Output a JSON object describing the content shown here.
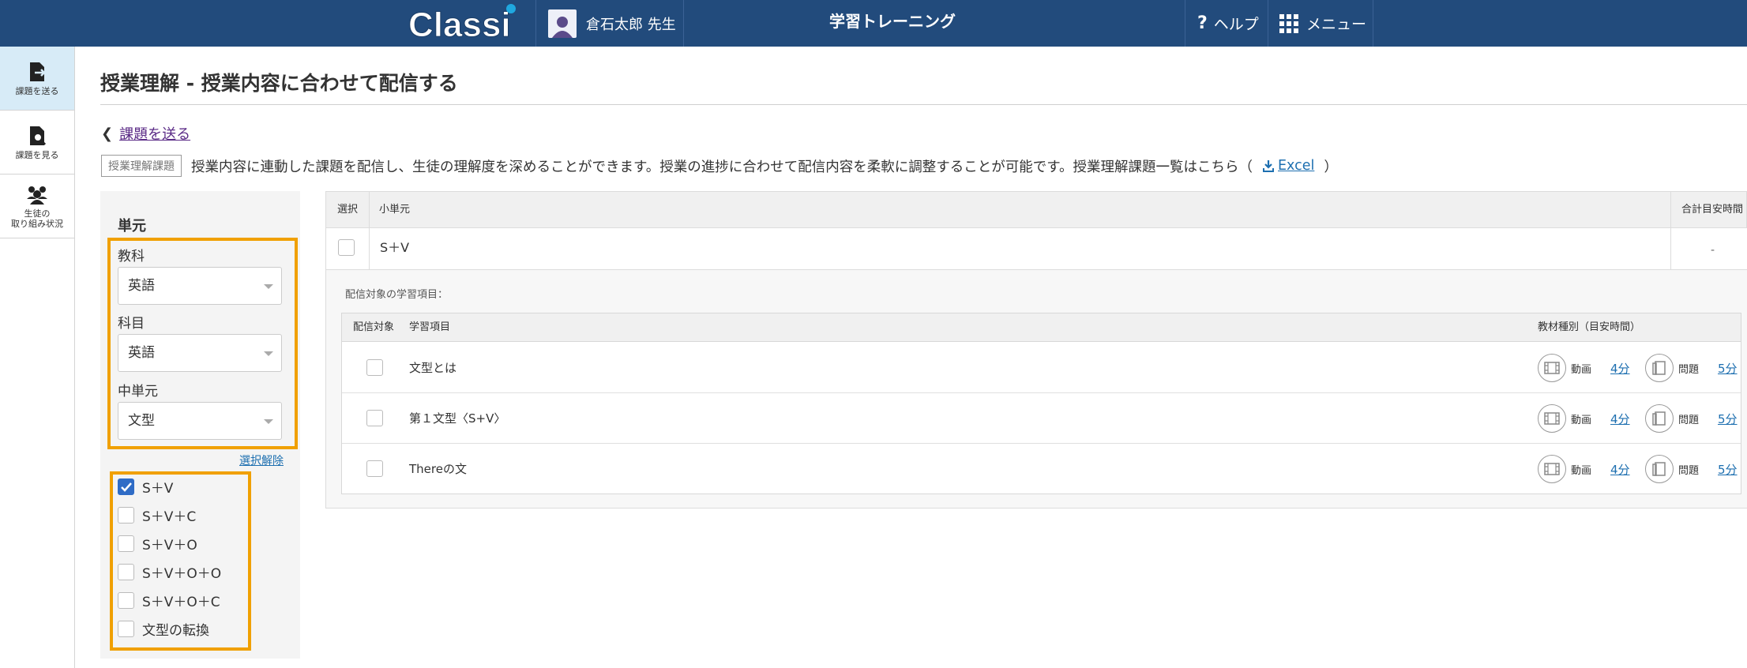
{
  "header": {
    "logo_text": "Classi",
    "user_name": "倉石太郎 先生",
    "app_title": "学習トレーニング",
    "help_label": "ヘルプ",
    "menu_label": "メニュー",
    "colors": {
      "bar": "#224b7c",
      "logo_accent": "#1fa8e0"
    }
  },
  "leftnav": {
    "items": [
      {
        "label_lines": [
          "課題を送る"
        ],
        "icon": "send-assignment-icon",
        "active": true
      },
      {
        "label_lines": [
          "課題を見る"
        ],
        "icon": "view-assignment-icon",
        "active": false
      },
      {
        "label_lines": [
          "生徒の",
          "取り組み状況"
        ],
        "icon": "students-icon",
        "active": false
      }
    ]
  },
  "page": {
    "title": "授業理解 - 授業内容に合わせて配信する",
    "back_link": "課題を送る",
    "badge": "授業理解課題",
    "description": "授業内容に連動した課題を配信し、生徒の理解度を深めることができます。授業の進捗に合わせて配信内容を柔軟に調整することが可能です。授業理解課題一覧はこちら（",
    "excel_label": "Excel",
    "description_end": "）"
  },
  "filter": {
    "title": "単元",
    "subject_label": "教科",
    "subject_value": "英語",
    "course_label": "科目",
    "course_value": "英語",
    "unit_label": "中単元",
    "unit_value": "文型",
    "clear_link": "選択解除",
    "items": [
      {
        "label": "S＋V",
        "checked": true
      },
      {
        "label": "S＋V＋C",
        "checked": false
      },
      {
        "label": "S＋V＋O",
        "checked": false
      },
      {
        "label": "S＋V＋O＋O",
        "checked": false
      },
      {
        "label": "S＋V＋O＋C",
        "checked": false
      },
      {
        "label": "文型の転換",
        "checked": false
      }
    ],
    "highlight_color": "#f0a000"
  },
  "table": {
    "col_select": "選択",
    "col_subunit": "小単元",
    "col_total": "合計目安時間",
    "row": {
      "subunit": "S＋V",
      "total": "-"
    },
    "detail_label": "配信対象の学習項目：",
    "inner": {
      "col_target": "配信対象",
      "col_item": "学習項目",
      "col_material": "教材種別（目安時間）",
      "video_label": "動画",
      "problem_label": "問題",
      "rows": [
        {
          "name": "文型とは",
          "video_time": "4分",
          "problem_time": "5分"
        },
        {
          "name": "第１文型〈S+V〉",
          "video_time": "4分",
          "problem_time": "5分"
        },
        {
          "name": "Thereの文",
          "video_time": "4分",
          "problem_time": "5分"
        }
      ]
    }
  }
}
